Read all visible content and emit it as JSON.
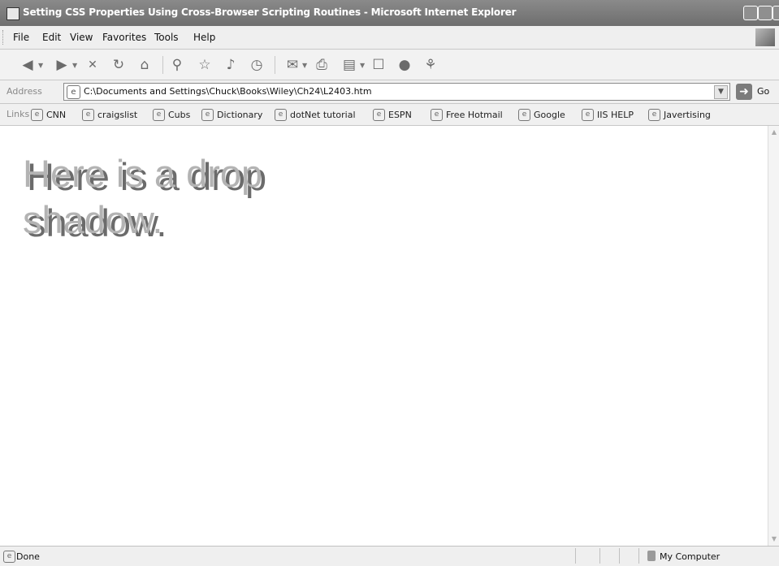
{
  "window": {
    "title": "Setting CSS Properties Using Cross-Browser Scripting Routines - Microsoft Internet Explorer",
    "page_icon": "ie-page-icon"
  },
  "menu": {
    "items": [
      "File",
      "Edit",
      "View",
      "Favorites",
      "Tools",
      "Help"
    ]
  },
  "toolbar": {
    "icons": [
      "back-icon",
      "forward-icon",
      "stop-icon",
      "refresh-icon",
      "home-icon",
      "search-icon",
      "favorites-star-icon",
      "media-icon",
      "history-icon",
      "mail-icon",
      "print-icon",
      "edit-icon",
      "discuss-icon",
      "messenger-icon",
      "research-icon"
    ]
  },
  "address": {
    "label": "Address",
    "value": "C:\\Documents and Settings\\Chuck\\Books\\Wiley\\Ch24\\L2403.htm",
    "go_label": "Go"
  },
  "links": {
    "label": "Links",
    "items": [
      "CNN",
      "craigslist",
      "Cubs",
      "Dictionary",
      "dotNet tutorial",
      "ESPN",
      "Free Hotmail",
      "Google",
      "IIS HELP",
      "Javertising"
    ]
  },
  "content": {
    "drop_shadow_text": "Here is a drop shadow."
  },
  "status": {
    "text": "Done",
    "zone": "My Computer"
  }
}
